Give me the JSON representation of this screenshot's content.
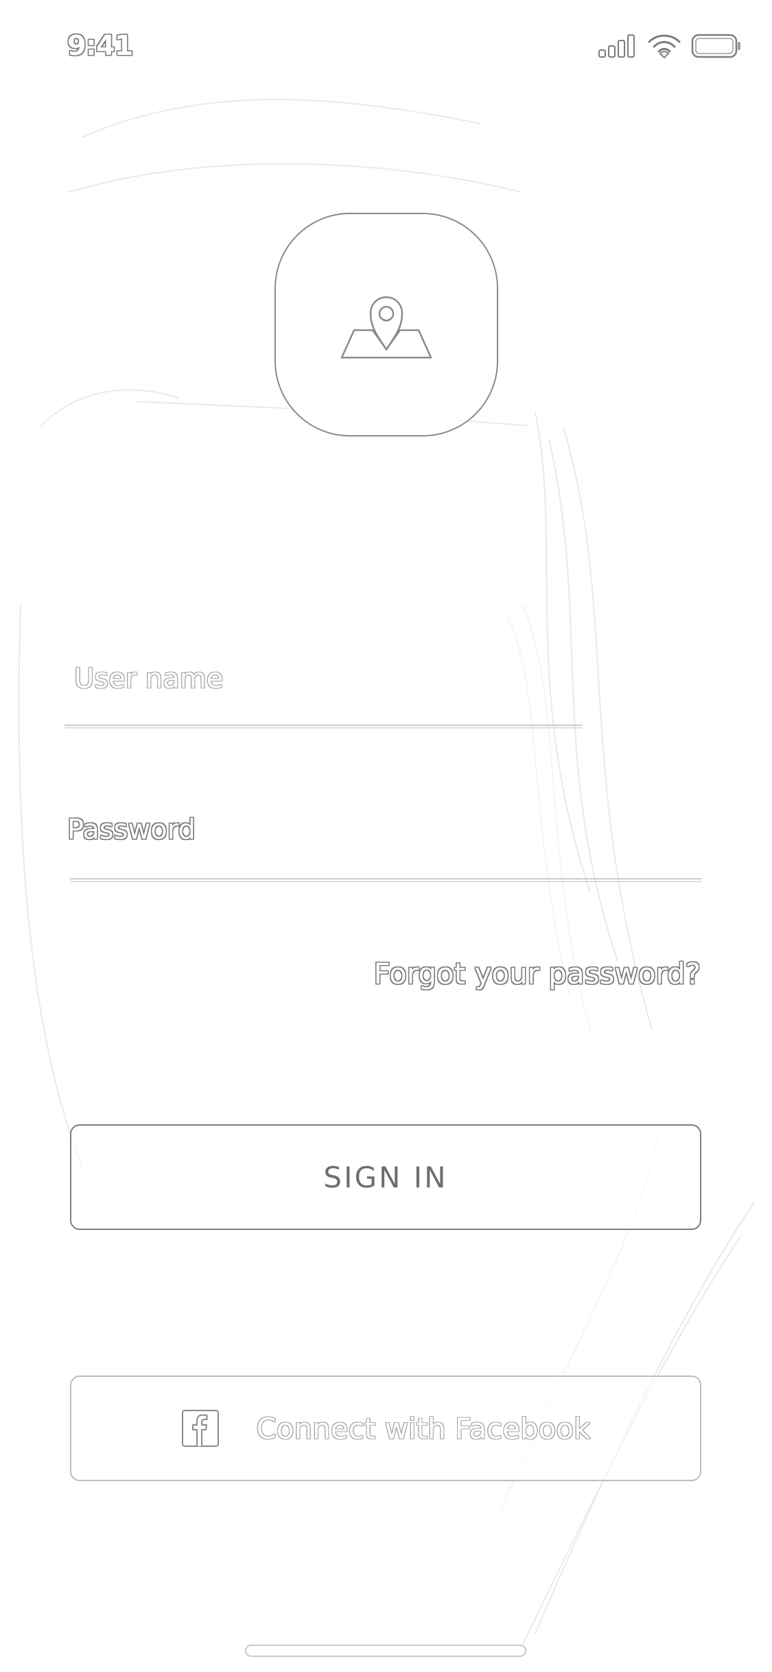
{
  "status_bar": {
    "time": "9:41",
    "icons": [
      "cellular-signal-icon",
      "wifi-icon",
      "battery-icon"
    ]
  },
  "logo": {
    "icon": "map-pin-icon"
  },
  "form": {
    "username": {
      "placeholder": "User name",
      "value": ""
    },
    "password": {
      "placeholder": "Password",
      "value": ""
    },
    "forgot_link": "Forgot your password?"
  },
  "buttons": {
    "sign_in": "SIGN IN",
    "facebook": "Connect with Facebook",
    "facebook_icon": "facebook-icon"
  },
  "colors": {
    "outline": "#7c7c7c",
    "background": "#ffffff"
  }
}
